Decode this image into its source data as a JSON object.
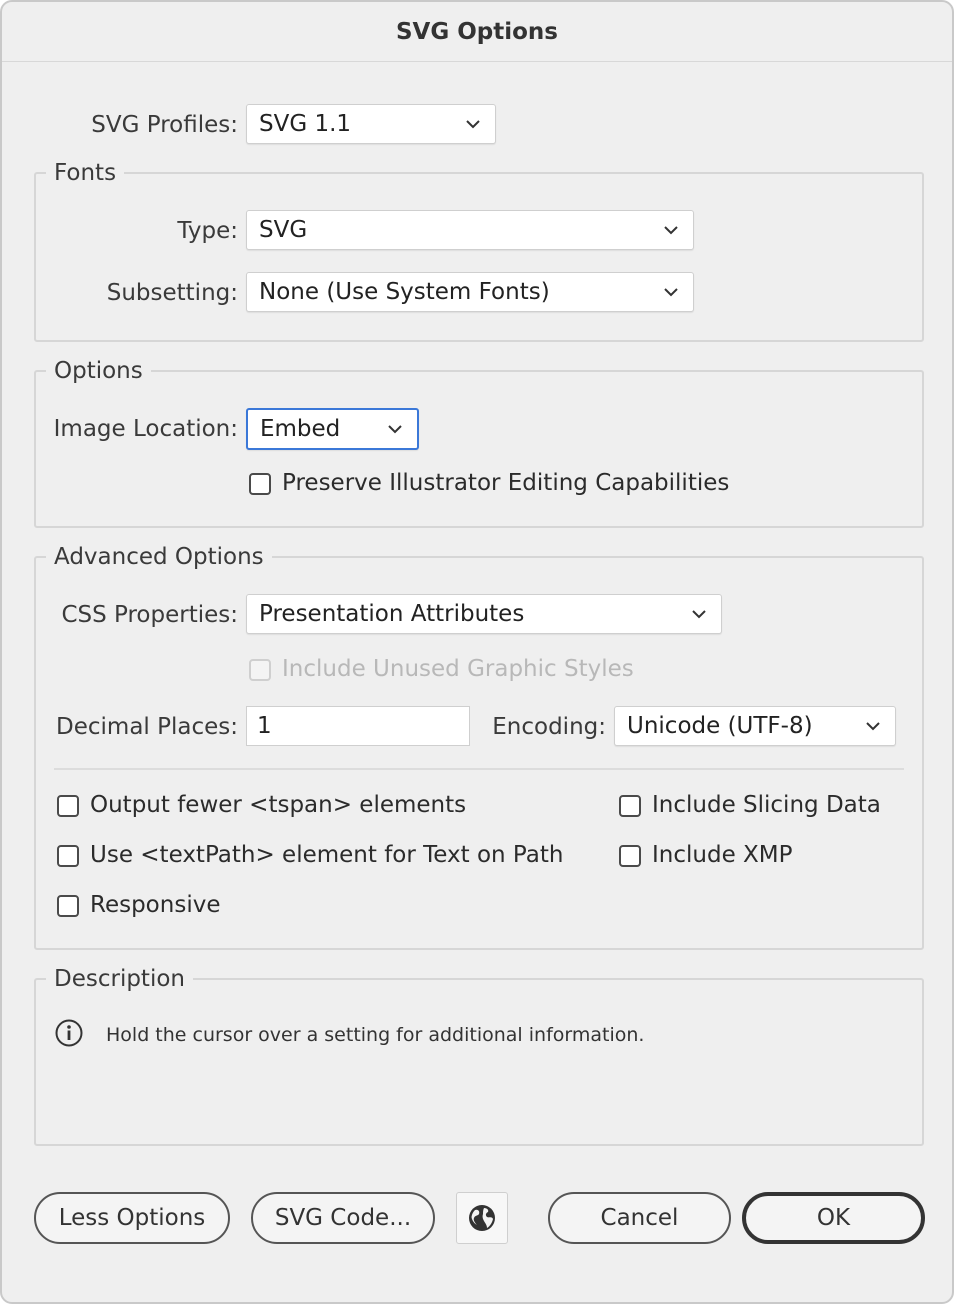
{
  "dialog": {
    "title": "SVG Options"
  },
  "profile": {
    "label": "SVG Profiles:",
    "value": "SVG 1.1"
  },
  "fonts": {
    "legend": "Fonts",
    "type_label": "Type:",
    "type_value": "SVG",
    "subsetting_label": "Subsetting:",
    "subsetting_value": "None (Use System Fonts)"
  },
  "options": {
    "legend": "Options",
    "image_location_label": "Image Location:",
    "image_location_value": "Embed",
    "preserve_label": "Preserve Illustrator Editing Capabilities"
  },
  "advanced": {
    "legend": "Advanced Options",
    "css_label": "CSS Properties:",
    "css_value": "Presentation Attributes",
    "unused_styles_label": "Include Unused Graphic Styles",
    "decimal_label": "Decimal Places:",
    "decimal_value": "1",
    "encoding_label": "Encoding:",
    "encoding_value": "Unicode (UTF-8)",
    "fewer_tspan_label": "Output fewer <tspan> elements",
    "textpath_label": "Use <textPath> element for Text on Path",
    "responsive_label": "Responsive",
    "slicing_label": "Include Slicing Data",
    "xmp_label": "Include XMP"
  },
  "description": {
    "legend": "Description",
    "text": "Hold the cursor over a setting for additional information."
  },
  "buttons": {
    "less_options": "Less Options",
    "svg_code": "SVG Code...",
    "cancel": "Cancel",
    "ok": "OK"
  },
  "icons": {
    "info": "info-icon",
    "globe": "globe-icon",
    "chevron": "chevron-down-icon"
  },
  "colors": {
    "focus": "#3b78d8",
    "background": "#efefef"
  }
}
